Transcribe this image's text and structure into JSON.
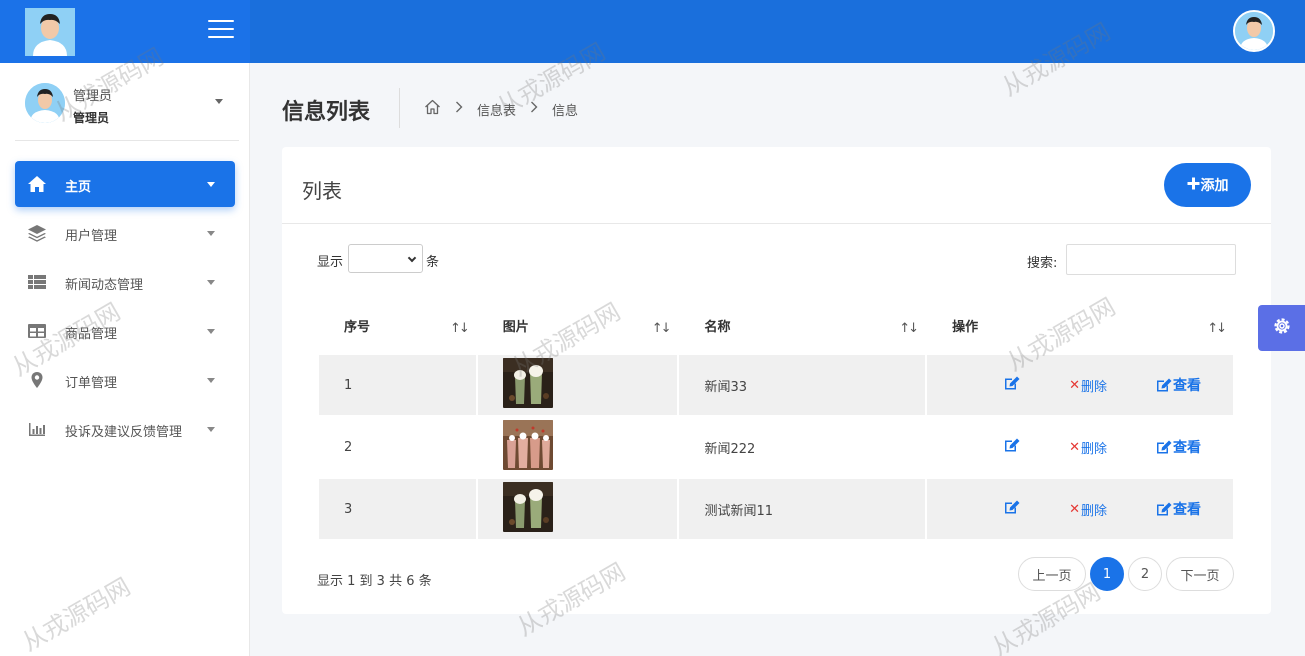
{
  "header": {
    "menu_toggle_icon": "hamburger-icon"
  },
  "sidebar": {
    "user": {
      "name": "管理员",
      "role": "管理员"
    },
    "items": [
      {
        "label": "主页",
        "icon": "home-icon",
        "active": true
      },
      {
        "label": "用户管理",
        "icon": "layers-icon"
      },
      {
        "label": "新闻动态管理",
        "icon": "list-icon"
      },
      {
        "label": "商品管理",
        "icon": "table-icon"
      },
      {
        "label": "订单管理",
        "icon": "map-pin-icon"
      },
      {
        "label": "投诉及建议反馈管理",
        "icon": "bar-chart-icon"
      }
    ]
  },
  "page": {
    "title": "信息列表",
    "breadcrumb": [
      "信息表",
      "信息"
    ]
  },
  "card": {
    "title": "列表",
    "add_label": "添加",
    "show_label": "显示",
    "show_suffix": "条",
    "search_label": "搜索:",
    "columns": [
      "序号",
      "图片",
      "名称",
      "操作"
    ],
    "rows": [
      {
        "index": "1",
        "name": "新闻33",
        "image": "drink-photo-1"
      },
      {
        "index": "2",
        "name": "新闻222",
        "image": "drink-photo-2"
      },
      {
        "index": "3",
        "name": "测试新闻11",
        "image": "drink-photo-1"
      }
    ],
    "actions": {
      "delete": "删除",
      "view": "查看"
    },
    "page_info": "显示 1 到 3 共 6 条",
    "pagination": {
      "prev": "上一页",
      "pages": [
        "1",
        "2"
      ],
      "current": "1",
      "next": "下一页"
    }
  },
  "watermark": "从戎源码网",
  "colors": {
    "primary": "#1a73e8",
    "topbar": "#1a6fdc",
    "danger": "#e53935",
    "settings": "#5b6fe6"
  }
}
